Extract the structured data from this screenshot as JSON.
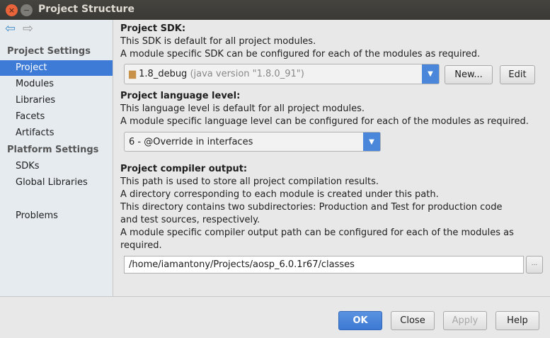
{
  "window": {
    "title": "Project Structure",
    "close_icon": "×",
    "min_icon": "−"
  },
  "sidebar": {
    "back_icon": "⇦",
    "forward_icon": "⇨",
    "sections": [
      {
        "label": "Project Settings",
        "items": [
          "Project",
          "Modules",
          "Libraries",
          "Facets",
          "Artifacts"
        ]
      },
      {
        "label": "Platform Settings",
        "items": [
          "SDKs",
          "Global Libraries"
        ]
      }
    ],
    "problems": "Problems",
    "selected": "Project"
  },
  "sdk": {
    "heading": "Project SDK:",
    "line1": "This SDK is default for all project modules.",
    "line2": "A module specific SDK can be configured for each of the modules as required.",
    "value": "1.8_debug",
    "detail": "(java version \"1.8.0_91\")",
    "new_label": "New...",
    "edit_label": "Edit"
  },
  "language": {
    "heading": "Project language level:",
    "line1": "This language level is default for all project modules.",
    "line2": "A module specific language level can be configured for each of the modules as required.",
    "value": "6 - @Override in interfaces"
  },
  "compiler": {
    "heading": "Project compiler output:",
    "lines": [
      "This path is used to store all project compilation results.",
      "A directory corresponding to each module is created under this path.",
      "This directory contains two subdirectories: Production and Test for production code",
      "and test sources, respectively.",
      "A module specific compiler output path can be configured for each of the modules as",
      "required."
    ],
    "path": "/home/iamantony/Projects/aosp_6.0.1r67/classes",
    "browse_label": "..."
  },
  "footer": {
    "ok": "OK",
    "close": "Close",
    "apply": "Apply",
    "help": "Help"
  },
  "colors": {
    "accent": "#3d7bd6"
  }
}
